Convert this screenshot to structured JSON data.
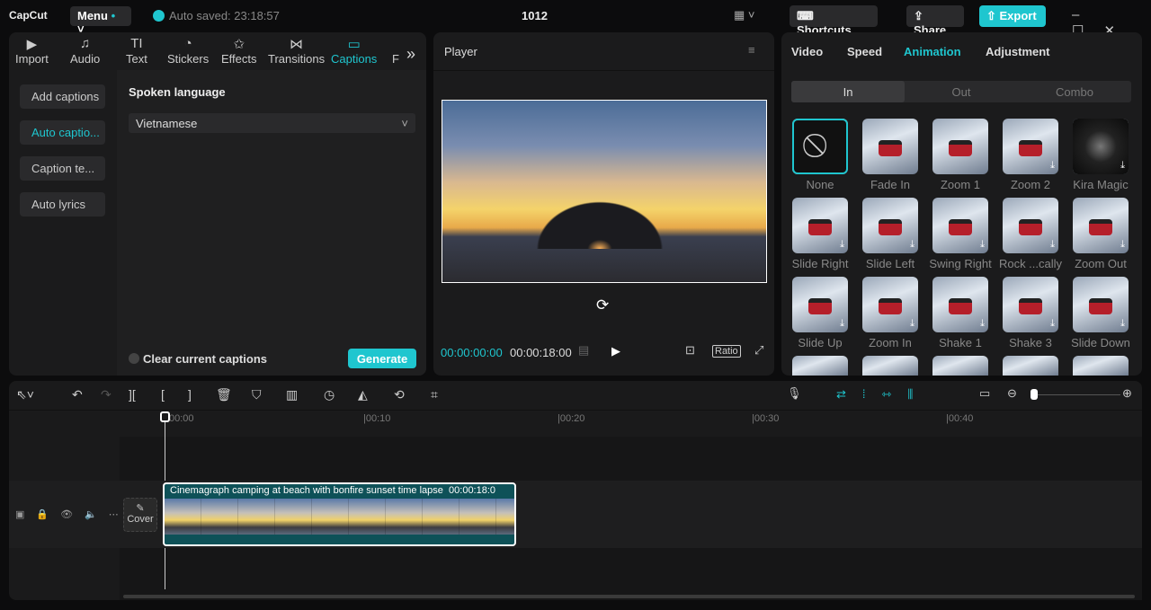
{
  "app": {
    "logo": "CapCut",
    "menu": "Menu",
    "autosave": "Auto saved: 23:18:57",
    "title": "1012",
    "shortcuts": "Shortcuts",
    "share": "Share",
    "export": "Export"
  },
  "media_tabs": [
    {
      "label": "Import",
      "icon": "▶"
    },
    {
      "label": "Audio",
      "icon": "♫"
    },
    {
      "label": "Text",
      "icon": "TI"
    },
    {
      "label": "Stickers",
      "icon": "◔"
    },
    {
      "label": "Effects",
      "icon": "✩"
    },
    {
      "label": "Transitions",
      "icon": "⋈"
    },
    {
      "label": "Captions",
      "icon": "▭"
    },
    {
      "label": "F",
      "icon": ""
    }
  ],
  "captions": {
    "side": [
      "Add captions",
      "Auto captio...",
      "Caption te...",
      "Auto lyrics"
    ],
    "spoken_label": "Spoken language",
    "language": "Vietnamese",
    "clear_label": "Clear current captions",
    "generate": "Generate"
  },
  "player": {
    "title": "Player",
    "current": "00:00:00:00",
    "total": "00:00:18:00",
    "ratio": "Ratio"
  },
  "inspector": {
    "tabs": [
      "Video",
      "Speed",
      "Animation",
      "Adjustment"
    ],
    "segments": [
      "In",
      "Out",
      "Combo"
    ],
    "animations": [
      "None",
      "Fade In",
      "Zoom 1",
      "Zoom 2",
      "Kira Magic",
      "Slide Right",
      "Slide Left",
      "Swing Right",
      "Rock ...cally",
      "Zoom Out",
      "Slide Up",
      "Zoom In",
      "Shake 1",
      "Shake 3",
      "Slide Down"
    ]
  },
  "timeline": {
    "ruler": [
      "00:00",
      "|00:10",
      "|00:20",
      "|00:30",
      "|00:40"
    ],
    "clip_title": "Cinemagraph camping at beach with bonfire sunset time lapse",
    "clip_duration": "00:00:18:0",
    "cover": "Cover"
  },
  "colors": {
    "accent": "#1fc6cf",
    "clip": "#0e5158"
  }
}
